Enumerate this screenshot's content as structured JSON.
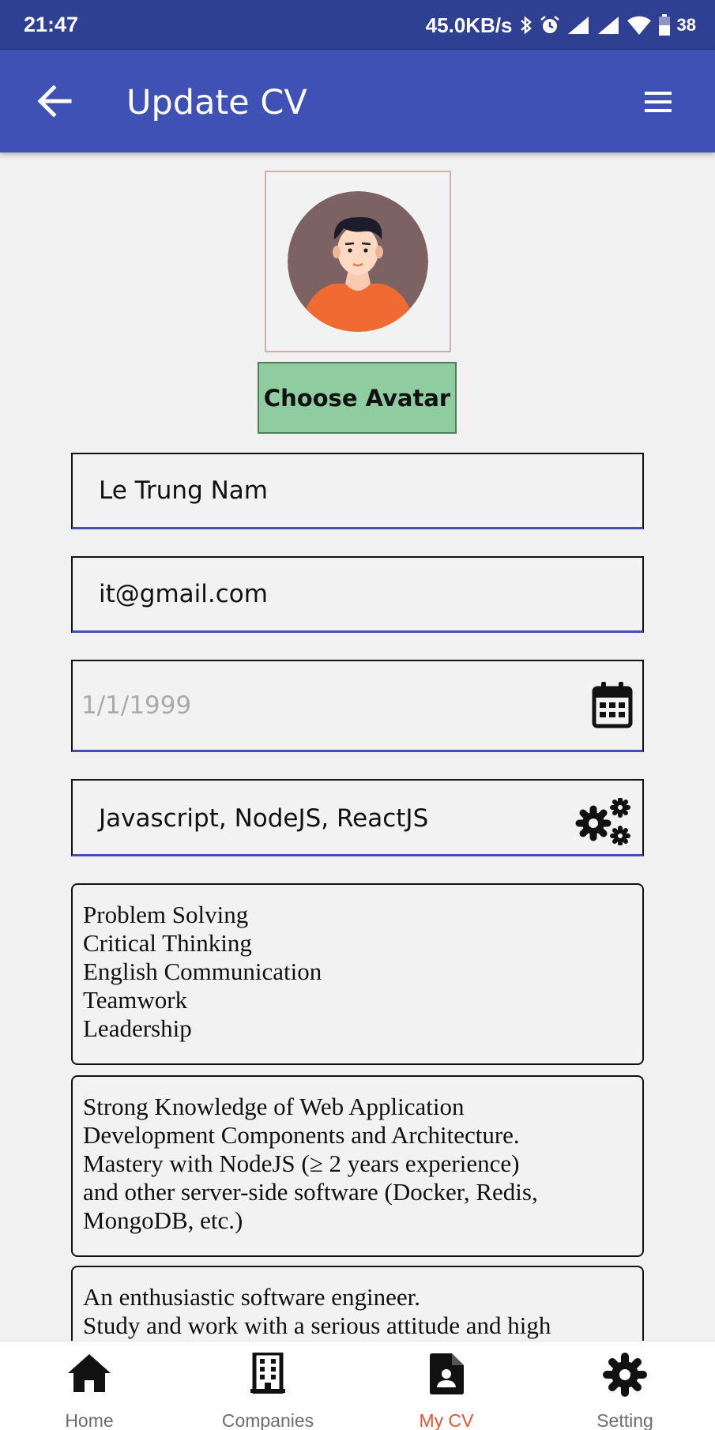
{
  "status_bar": {
    "time": "21:47",
    "network_speed": "45.0KB/s",
    "battery": "38",
    "icons": [
      "bluetooth-icon",
      "alarm-icon",
      "signal-icon",
      "signal-icon",
      "wifi-icon",
      "battery-icon"
    ]
  },
  "app_bar": {
    "title": "Update CV",
    "back_icon": "arrow-left-icon",
    "menu_icon": "hamburger-menu-icon",
    "color": "#3f51b5"
  },
  "avatar": {
    "button_label": "Choose Avatar",
    "button_color": "#8fcc9f"
  },
  "form": {
    "name_value": "Le Trung Nam",
    "email_value": "it@gmail.com",
    "birthday_placeholder": "1/1/1999",
    "birthday_icon": "calendar-icon",
    "skills_value": "Javascript, NodeJS, ReactJS",
    "skills_icon": "gears-icon",
    "soft_skills": [
      "Problem Solving",
      "Critical Thinking",
      "English Communication",
      "Teamwork",
      "Leadership"
    ],
    "experience": [
      "Strong Knowledge of Web Application",
      "Development Components and Architecture.",
      "Mastery with NodeJS (≥ 2 years experience)",
      "and other server-side software (Docker, Redis,",
      "MongoDB, etc.)"
    ],
    "objective": [
      "An enthusiastic software engineer.",
      "Study and work with a serious attitude and high"
    ]
  },
  "bottom_nav": {
    "items": [
      {
        "label": "Home",
        "icon": "home-icon"
      },
      {
        "label": "Companies",
        "icon": "building-icon"
      },
      {
        "label": "My CV",
        "icon": "cv-document-icon"
      },
      {
        "label": "Setting",
        "icon": "gear-icon"
      }
    ],
    "active_index": 2,
    "active_color": "#e2553a"
  }
}
